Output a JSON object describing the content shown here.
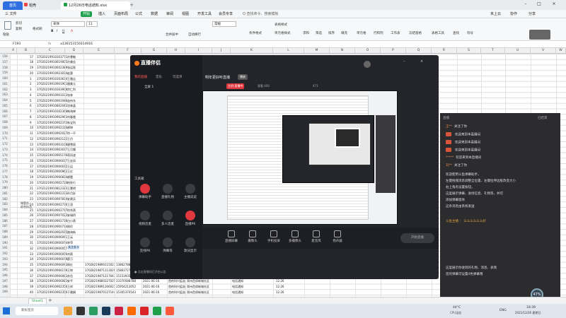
{
  "titlebar": {
    "home_tab": "首页",
    "tab1": "稻壳",
    "tab2": "12月26日电话通知.xlsx"
  },
  "menu": {
    "file": "三 文件",
    "items": [
      "开始",
      "插入",
      "页面布局",
      "公式",
      "数据",
      "审阅",
      "视图",
      "开发工具",
      "会员专享"
    ],
    "search": "Q 查找命令、搜索模板",
    "right": [
      "未上云",
      "协作",
      "分享"
    ]
  },
  "ribbon": {
    "paste": "粘贴",
    "cut": "剪切",
    "copy": "复制",
    "format_painter": "格式刷",
    "font_name": "宋体",
    "font_size": "11",
    "merge": "合并居中",
    "wrap": "自动换行",
    "number_format": "常规",
    "cond_format": "条件格式",
    "table_style": "表格样式",
    "cell_style": "单元格样式",
    "sum": "求和",
    "filter": "筛选",
    "sort": "排序",
    "fill": "填充",
    "cell": "单元格",
    "rowcol": "行和列",
    "worksheet": "工作表",
    "freeze": "冻结窗格",
    "table_tool": "表格工具",
    "find": "查找",
    "symbol": "符号"
  },
  "formula_bar": {
    "cell_ref": "F193",
    "value": "     a136153150314916"
  },
  "columns": [
    "A",
    "B",
    "C",
    "D",
    "E",
    "F",
    "G",
    "H",
    "I",
    "J",
    "K",
    "L",
    "M",
    "N",
    "O",
    "P",
    "Q",
    "R",
    "S",
    "T",
    "U",
    "V",
    "W"
  ],
  "row_numbers": [
    "156",
    "157",
    "158",
    "159",
    "160",
    "161",
    "162",
    "163",
    "164",
    "165",
    "166",
    "167",
    "168",
    "169",
    "170",
    "171",
    "172",
    "173",
    "174",
    "175",
    "176",
    "177",
    "178",
    "179",
    "180",
    "181",
    "182",
    "183",
    "184",
    "185",
    "186",
    "187",
    "188",
    "189",
    "190",
    "191",
    "192",
    "193",
    "194",
    "195",
    "196",
    "197",
    "198",
    "199"
  ],
  "col_b": [
    "17",
    "18",
    "19",
    "20",
    "1",
    "2",
    "3",
    "4",
    "5",
    "6",
    "7",
    "8",
    "9",
    "10",
    "11",
    "12",
    "13",
    "14",
    "15",
    "16",
    "17",
    "18",
    "19",
    "20",
    "21",
    "22",
    "23",
    "24",
    "25",
    "26",
    "27",
    "28",
    "29",
    "30",
    "31",
    "32",
    "33",
    "34",
    "35",
    "36",
    "37",
    "38",
    "39",
    "40"
  ],
  "col_c": [
    "37020219910303771",
    "37020219910619005",
    "37020219910602389",
    "37020219910923034",
    "37020219910303634",
    "37020219910901901",
    "37020219910303908",
    "37020219910901033",
    "37020219910901946",
    "37020219910802043",
    "37020219910302366",
    "37020219910902963",
    "37020219910902373",
    "37020219910902310",
    "37020219910902027",
    "37020219910902123",
    "37020219910903108",
    "37020219910903017",
    "37020219910905176",
    "37020219910906017",
    "37020219910906012",
    "37020219910900962",
    "37020219910906814",
    "37020219910902720",
    "37021219910812323",
    "37020219910902333",
    "37020219910907834",
    "37020219910902736",
    "37020219910902717",
    "37020219910907023",
    "37020219910902716",
    "37020219910900714",
    "37020219910902015",
    "37020219910906091",
    "37020219910906074",
    "37020219910906057",
    "37020219910906056",
    "37020219910906079",
    "37020219910906093",
    "37020219910906179",
    "37020219910906062",
    "37020219910906083",
    "37020219910902356",
    "37020219910902356"
  ],
  "col_d": [
    "孙慧敏",
    "孙美佳",
    "张运智",
    "赵惠",
    "王雅吉",
    "唐美元",
    "宗仁利",
    "张林",
    "苗伟东",
    "沈林晶",
    "韩海婷",
    "刘春霞",
    "朱宝利",
    "郝坤",
    "徐一平",
    "王丹",
    "唐雪丽",
    "王月娥",
    "蒋凤波",
    "王宏凤",
    "王运",
    "王红",
    "郝霞",
    "柏秋行",
    "王慧明",
    "孙月彩",
    "安建兵",
    "王茂",
    "徐秀燕",
    "安瑞桥",
    "白小燕",
    "周玲",
    "路海新",
    "王云",
    "李萍",
    "王继",
    "刘燕",
    "薛万",
    "周红",
    "王坤",
    "苏岳",
    "安平",
    "王祥",
    "于雅娟"
  ],
  "row_labels": {
    "merged_label": "城管办、综合执法",
    "row_191_note": "关注发卡"
  },
  "extra_rows": [
    {
      "e": "37028219890115023",
      "f": "13862788220",
      "g": "2021-06-16",
      "h": "首剂科兴疫苗",
      "i": "郑州西郊新城社区",
      "j": "电话通知",
      "k": "12.26"
    },
    {
      "e": "37028219871113029",
      "f": "15863727897",
      "g": "2021-06-16",
      "h": "首剂科兴疫苗",
      "i": "郑州西郊新城社区",
      "j": "电话通知",
      "k": "12.26"
    },
    {
      "e": "37028219871217643",
      "f": "15153935805",
      "g": "2021-06-16",
      "h": "首剂科兴疫苗",
      "i": "郑州西郊新城社区",
      "j": "电话通知",
      "k": "12.26"
    },
    {
      "e": "37028219880327025",
      "f": "13370588788",
      "g": "2021-06-16",
      "h": "首剂科兴疫苗",
      "i": "郑州西郊新城社区",
      "j": "电话通知",
      "k": "12.26"
    },
    {
      "e": "37028219891306021",
      "f": "15954213052",
      "g": "2021-06-16",
      "h": "首剂科兴疫苗",
      "i": "郑州西郊新城社区",
      "j": "电话通知",
      "k": "12.26"
    },
    {
      "e": "37028219870127144",
      "f": "15305370543",
      "g": "2021-06-16",
      "h": "首剂科兴疫苗",
      "i": "郑州西郊新城社区",
      "j": "电话通知",
      "k": "12.26"
    }
  ],
  "sheet_tab": "Sheet1",
  "stream": {
    "app_name": "直播伴侣",
    "tabs": [
      "我的直播",
      "音乐",
      "可选项"
    ],
    "scene": "全屏 1",
    "live_title": "明年更好听直播",
    "live_badge": "播放",
    "stat_label": "主机:直播中",
    "stat_audience": "观看 400",
    "viewer_count": "471",
    "tools_label": "工具箱",
    "tools": [
      {
        "label": "弹幕助手",
        "red": true
      },
      {
        "label": "直播礼物",
        "red": false
      },
      {
        "label": "主播说说",
        "red": false
      },
      {
        "label": "视频连麦",
        "red": false
      },
      {
        "label": "多人连麦",
        "red": false
      },
      {
        "label": "直播PK",
        "red": true
      },
      {
        "label": "连线PK",
        "red": false
      },
      {
        "label": "弹幕等",
        "red": false
      },
      {
        "label": "歌词显示",
        "red": false
      }
    ],
    "notice": "● 点击直播间已开启公告",
    "controls": [
      "直播屏幕",
      "摄像头",
      "手机投屏",
      "多摄像头",
      "麦克风",
      "扬声器"
    ],
    "start_button": "开始直播"
  },
  "chat": {
    "header_left": "直播",
    "header_right": "已结束",
    "messages": [
      {
        "user": "王**",
        "text": "关注了你",
        "gift": false
      },
      {
        "user": "",
        "text": "欢迎来到本直播间",
        "gift": true
      },
      {
        "user": "",
        "text": "欢迎来到本直播间",
        "gift": true
      },
      {
        "user": "",
        "text": "欢迎来到本直播间",
        "gift": true
      },
      {
        "user": "*****",
        "text": "欢迎来到本直播间",
        "gift": false
      },
      {
        "user": "刘**",
        "text": "关注了你",
        "gift": false
      }
    ],
    "system_lines": [
      "欢迎使用斗鱼弹幕助手，",
      "左键拖拽消息调整全位置、左键拉伸边框改变大小",
      "右上角有设置按钮，",
      "这里展示弹幕、进场信息、礼物等，并可",
      "添加弹幕窗体",
      "这条消息由系统发送"
    ],
    "highlight_line": "斗鱼主播 ： 么么么么么么好",
    "footer_lines": [
      "这里展示你收到的礼物、消息、表情",
      "您的弹幕可设置4色弹幕哦"
    ],
    "percent": "47%"
  },
  "taskbar": {
    "search_label": "新标签页",
    "temp": "44°C",
    "temp_label": "CPU温度",
    "lang": "ENG",
    "time": "18:39",
    "date": "2021/12/26 星期日"
  }
}
